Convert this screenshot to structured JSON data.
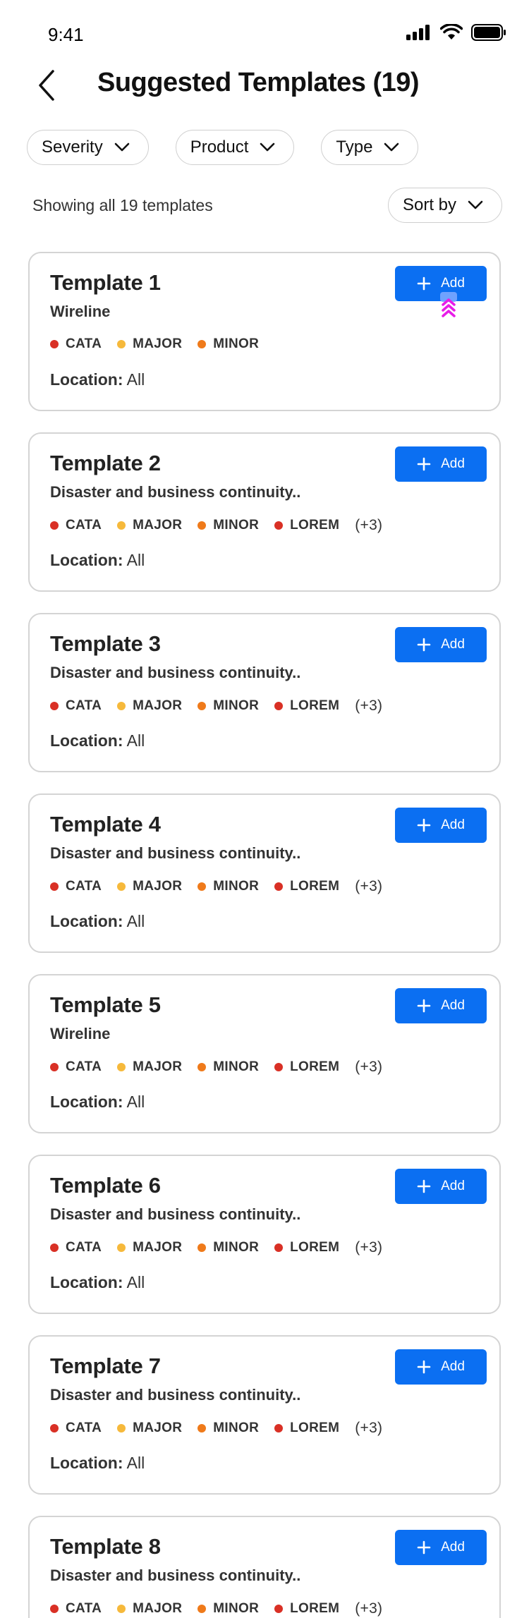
{
  "status_bar": {
    "time": "9:41"
  },
  "header": {
    "title": "Suggested Templates (19)"
  },
  "filters": [
    {
      "label": "Severity"
    },
    {
      "label": "Product"
    },
    {
      "label": "Type"
    }
  ],
  "results": {
    "count_text": "Showing all 19 templates",
    "sort_label": "Sort by"
  },
  "colors": {
    "accent": "#0b6ff2",
    "cata": "#d93025",
    "major": "#f6b93b",
    "minor": "#ef7a1a",
    "lorem": "#d93025"
  },
  "location_label": "Location:",
  "add_label": "Add",
  "cards": [
    {
      "title": "Template 1",
      "subtitle": "Wireline",
      "tags": [
        "CATA",
        "MAJOR",
        "MINOR"
      ],
      "more": "",
      "location": "All"
    },
    {
      "title": "Template 2",
      "subtitle": "Disaster and business continuity..",
      "tags": [
        "CATA",
        "MAJOR",
        "MINOR",
        "LOREM"
      ],
      "more": "(+3)",
      "location": "All"
    },
    {
      "title": "Template 3",
      "subtitle": "Disaster and business continuity..",
      "tags": [
        "CATA",
        "MAJOR",
        "MINOR",
        "LOREM"
      ],
      "more": "(+3)",
      "location": "All"
    },
    {
      "title": "Template 4",
      "subtitle": "Disaster and business continuity..",
      "tags": [
        "CATA",
        "MAJOR",
        "MINOR",
        "LOREM"
      ],
      "more": "(+3)",
      "location": "All"
    },
    {
      "title": "Template 5",
      "subtitle": "Wireline",
      "tags": [
        "CATA",
        "MAJOR",
        "MINOR",
        "LOREM"
      ],
      "more": "(+3)",
      "location": "All"
    },
    {
      "title": "Template 6",
      "subtitle": "Disaster and business continuity..",
      "tags": [
        "CATA",
        "MAJOR",
        "MINOR",
        "LOREM"
      ],
      "more": "(+3)",
      "location": "All"
    },
    {
      "title": "Template 7",
      "subtitle": "Disaster and business continuity..",
      "tags": [
        "CATA",
        "MAJOR",
        "MINOR",
        "LOREM"
      ],
      "more": "(+3)",
      "location": "All"
    },
    {
      "title": "Template 8",
      "subtitle": "Disaster and business continuity..",
      "tags": [
        "CATA",
        "MAJOR",
        "MINOR",
        "LOREM"
      ],
      "more": "(+3)",
      "location": "All"
    }
  ]
}
